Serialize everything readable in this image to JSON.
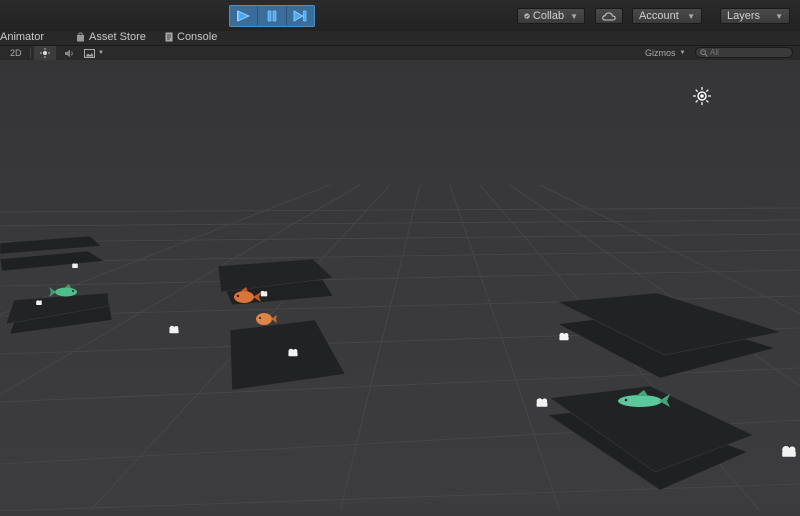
{
  "toolbar": {
    "play_label": "Play",
    "pause_label": "Pause",
    "step_label": "Step",
    "collab_label": "Collab",
    "account_label": "Account",
    "layers_label": "Layers"
  },
  "tabs": [
    {
      "label": "Animator"
    },
    {
      "label": "Asset Store"
    },
    {
      "label": "Console"
    }
  ],
  "scene_bar": {
    "mode_2d": "2D",
    "gizmos_label": "Gizmos",
    "search_placeholder": "All"
  },
  "colors": {
    "accent": "#3a6d99",
    "play_icon": "#4aa8ff",
    "background": "#3a3a3c"
  }
}
